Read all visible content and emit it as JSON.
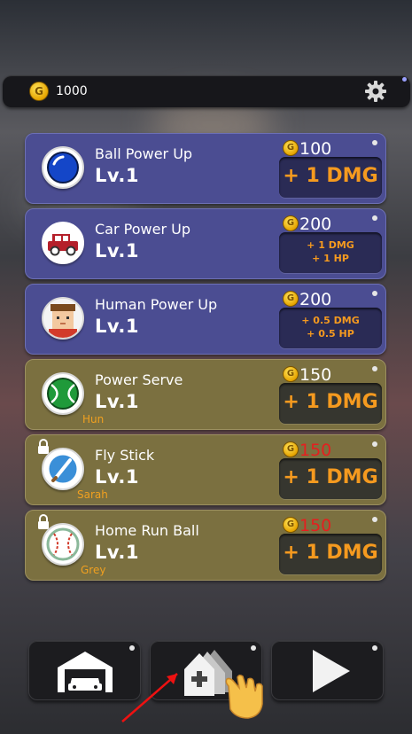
{
  "topbar": {
    "coins": "1000"
  },
  "cards": [
    {
      "title": "Ball Power Up",
      "level": "Lv.1",
      "price": "100",
      "upgrade": "+ 1 DMG",
      "icon": "ball-icon"
    },
    {
      "title": "Car Power Up",
      "level": "Lv.1",
      "price": "200",
      "upgrade_line1": "+ 1 DMG",
      "upgrade_line2": "+ 1 HP",
      "icon": "car-icon"
    },
    {
      "title": "Human Power Up",
      "level": "Lv.1",
      "price": "200",
      "upgrade_line1": "+ 0.5 DMG",
      "upgrade_line2": "+ 0.5 HP",
      "icon": "human-icon"
    },
    {
      "title": "Power Serve",
      "level": "Lv.1",
      "price": "150",
      "upgrade": "+ 1 DMG",
      "hero": "Hun",
      "icon": "tennis-ball-icon"
    },
    {
      "title": "Fly Stick",
      "level": "Lv.1",
      "price": "150",
      "upgrade": "+ 1 DMG",
      "hero": "Sarah",
      "icon": "fly-stick-icon",
      "locked": true
    },
    {
      "title": "Home Run Ball",
      "level": "Lv.1",
      "price": "150",
      "upgrade": "+ 1 DMG",
      "hero": "Grey",
      "icon": "baseball-icon",
      "locked": true
    }
  ],
  "colors": {
    "accent": "#f59a1f",
    "price_unaffordable": "#e51f1f",
    "hero_name": "#f0a020"
  },
  "bottom_nav": [
    "garage-icon",
    "upgrade-icon",
    "play-icon"
  ]
}
